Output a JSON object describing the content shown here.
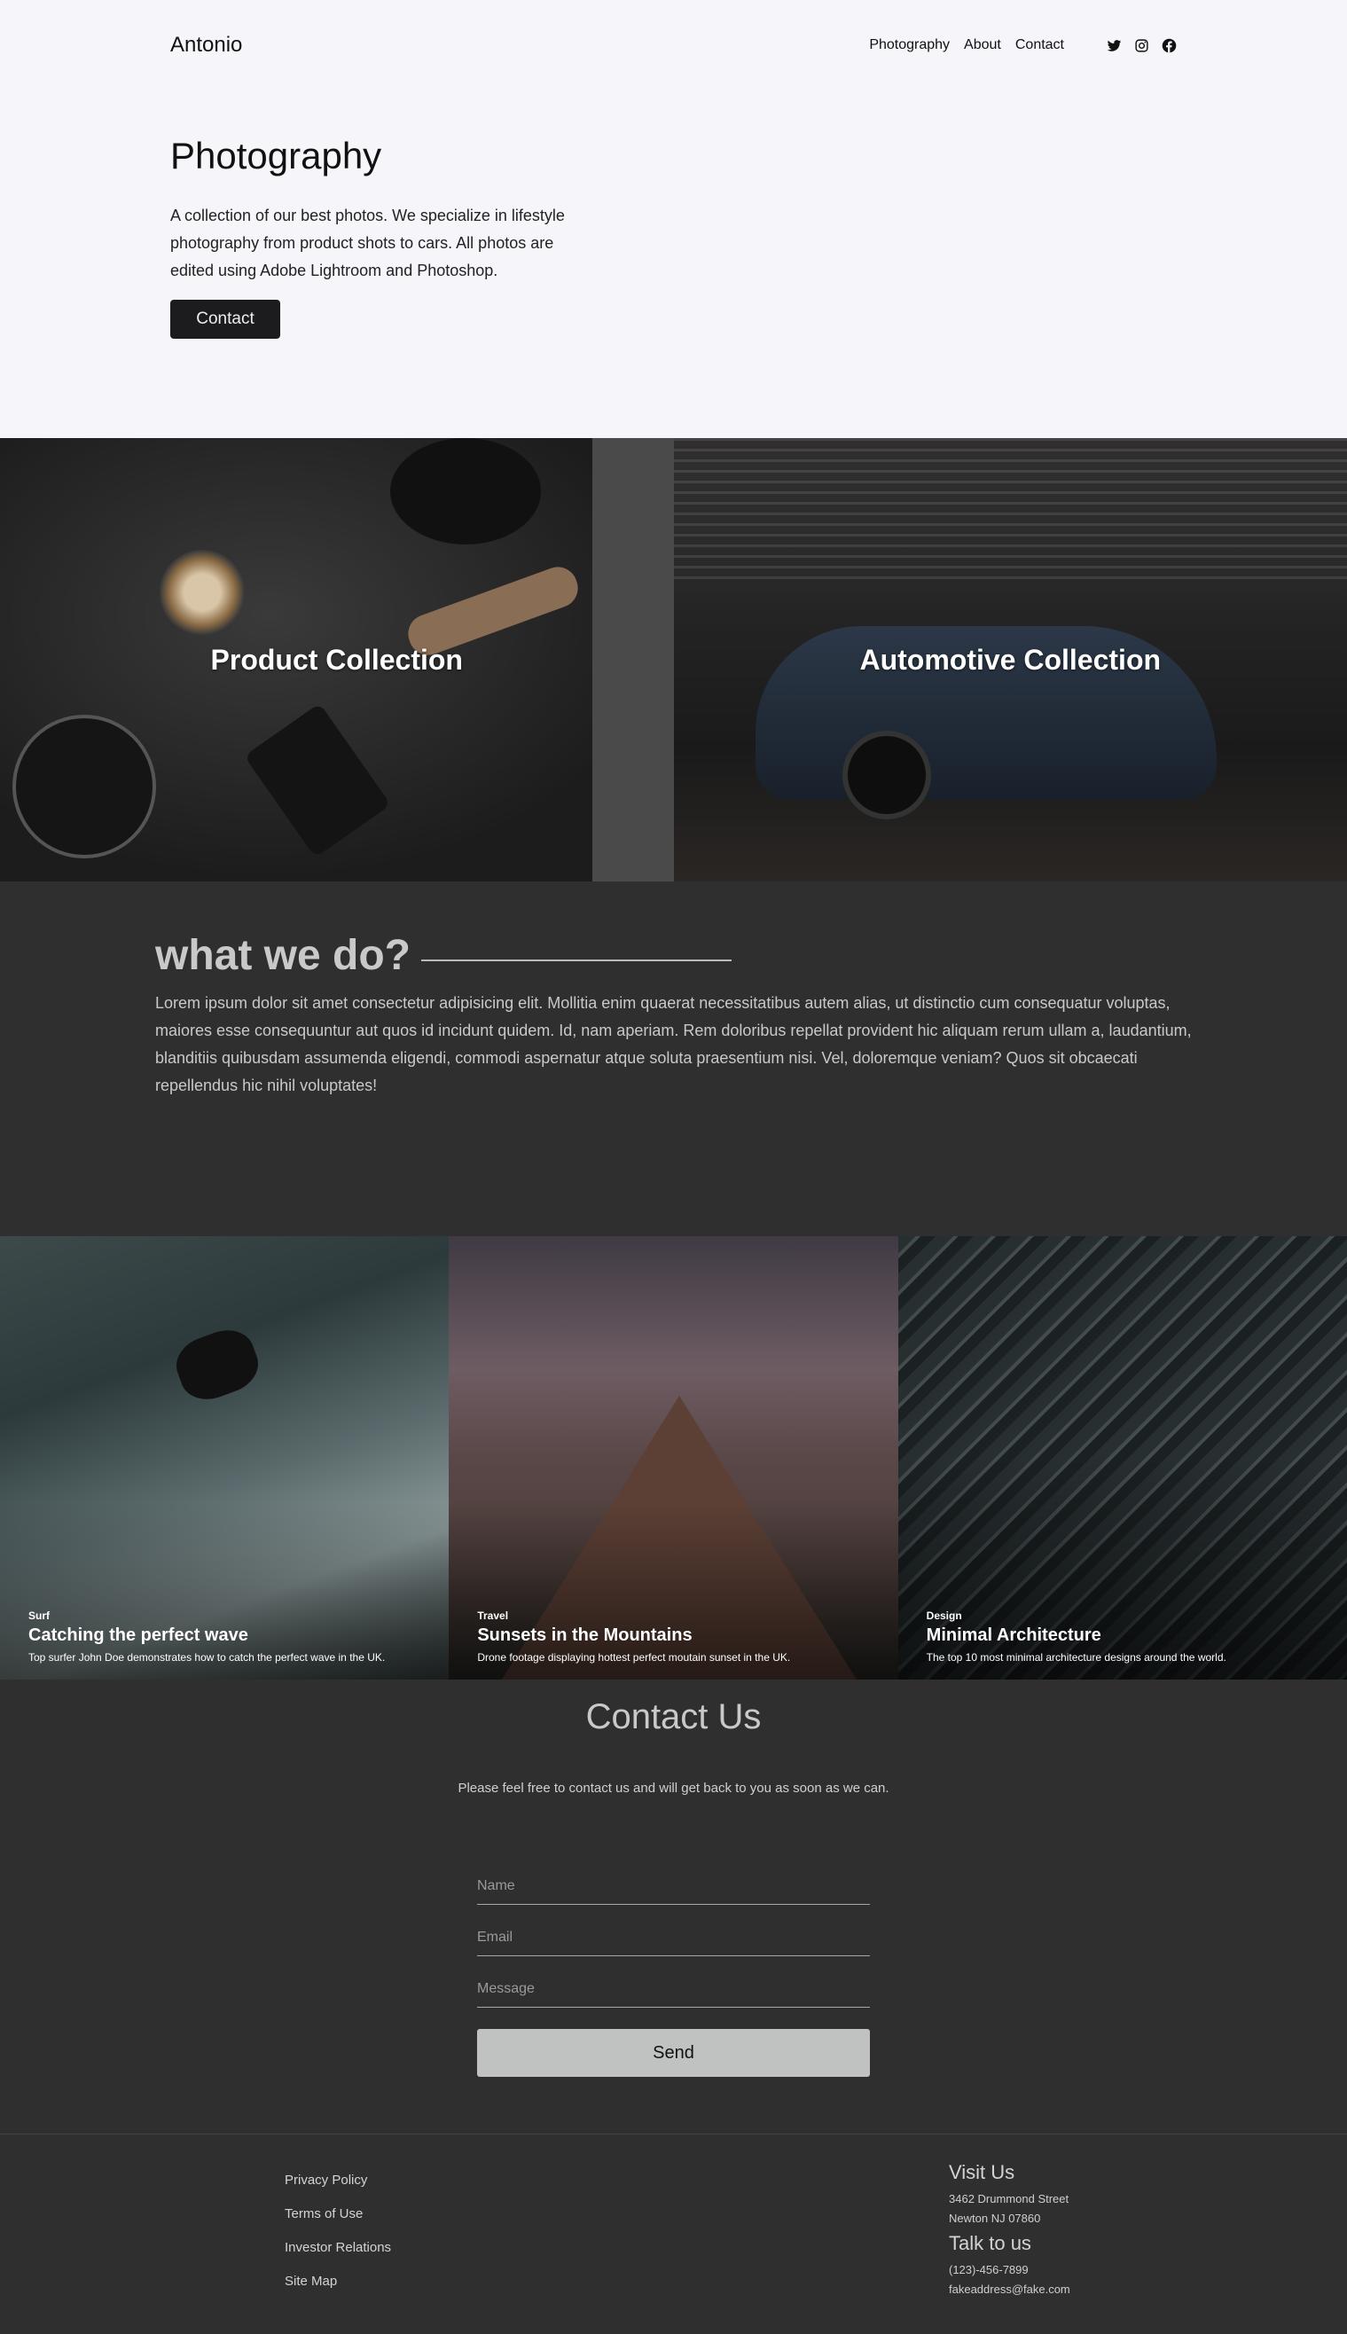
{
  "header": {
    "brand": "Antonio",
    "nav": [
      "Photography",
      "About",
      "Contact"
    ],
    "social_icons": [
      "twitter-icon",
      "instagram-icon",
      "facebook-icon"
    ]
  },
  "hero": {
    "title": "Photography",
    "description": "A collection of our best photos. We specialize in lifestyle photography from product shots to cars. All photos are edited using Adobe Lightroom and Photoshop.",
    "button_label": "Contact"
  },
  "collections": [
    {
      "title": "Product Collection"
    },
    {
      "title": "Automotive Collection"
    }
  ],
  "what_we_do": {
    "title": "what we do?",
    "text": "Lorem ipsum dolor sit amet consectetur adipisicing elit. Mollitia enim quaerat necessitatibus autem alias, ut distinctio cum consequatur voluptas, maiores esse consequuntur aut quos id incidunt quidem. Id, nam aperiam. Rem doloribus repellat provident hic aliquam rerum ullam a, laudantium, blanditiis quibusdam assumenda eligendi, commodi aspernatur atque soluta praesentium nisi. Vel, doloremque veniam? Quos sit obcaecati repellendus hic nihil voluptates!"
  },
  "gallery": [
    {
      "tag": "Surf",
      "title": "Catching the perfect wave",
      "subtitle": "Top surfer John Doe demonstrates how to catch the perfect wave in the UK."
    },
    {
      "tag": "Travel",
      "title": "Sunsets in the Mountains",
      "subtitle": "Drone footage displaying hottest perfect moutain sunset in the UK."
    },
    {
      "tag": "Design",
      "title": "Minimal Architecture",
      "subtitle": "The top 10 most minimal architecture designs around the world."
    }
  ],
  "contact": {
    "title": "Contact Us",
    "text": "Please feel free to contact us and will get back to you as soon as we can.",
    "name_placeholder": "Name",
    "email_placeholder": "Email",
    "message_placeholder": "Message",
    "send_label": "Send"
  },
  "footer": {
    "links": [
      "Privacy Policy",
      "Terms of Use",
      "Investor Relations",
      "Site Map"
    ],
    "visit_title": "Visit Us",
    "address_line1": "3462 Drummond Street",
    "address_line2": "Newton NJ 07860",
    "talk_title": "Talk to us",
    "phone": "(123)-456-7899",
    "email": "fakeaddress@fake.com"
  }
}
